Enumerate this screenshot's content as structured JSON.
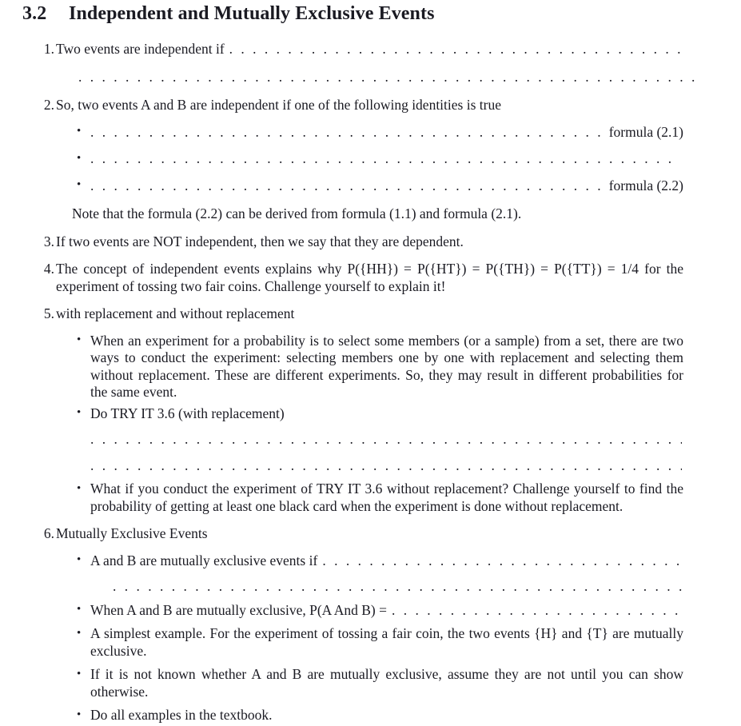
{
  "document": {
    "section_number": "3.2",
    "section_title": "Independent and Mutually Exclusive Events",
    "dot_filler": ". . . . . . . . . . . . . . . . . . . . . . . . . . . . . . . . . . . . . . . . . . . . . . . . . . . . . . . . . . . . . . . . . . . . . . . . . . . . . . . . . . . . . . . . . . . . . . . . . . . . . . . . . . . . . . . . . . . . . . . . . . . . . . . . . . . . . . . . . . . . . . . . . .",
    "bullet_glyph": "•"
  },
  "items": {
    "n1": {
      "marker": "1.",
      "text": "Two events are independent if"
    },
    "n2": {
      "marker": "2.",
      "text": "So, two events A and B are independent if one of the following identities is true",
      "bullets": {
        "b1_tail": "formula (2.1)",
        "b2_tail": "",
        "b3_tail": "formula (2.2)"
      },
      "note": "Note that the formula (2.2) can be derived from formula (1.1) and formula (2.1)."
    },
    "n3": {
      "marker": "3.",
      "text": "If two events are NOT independent, then we say that they are dependent."
    },
    "n4": {
      "marker": "4.",
      "text": "The concept of independent events explains why P({HH}) = P({HT}) = P({TH}) = P({TT}) = 1/4 for the experiment of tossing two fair coins. Challenge yourself to explain it!"
    },
    "n5": {
      "marker": "5.",
      "text": "with replacement and without replacement",
      "bullets": {
        "b1": "When an experiment for a probability is to select some members (or a sample) from a set, there are two ways to conduct the experiment: selecting members one by one with replacement and selecting them without replacement. These are different experiments. So, they may result in different probabilities for the same event.",
        "b2": "Do TRY IT 3.6 (with replacement)",
        "b3": "What if you conduct the experiment of TRY IT 3.6 without replacement? Challenge yourself to find the probability of getting at least one black card when the experiment is done without replacement."
      }
    },
    "n6": {
      "marker": "6.",
      "text": "Mutually Exclusive Events",
      "bullets": {
        "b1": "A and B are mutually exclusive events if",
        "b2": "When A and B are mutually exclusive, P(A And B) =",
        "b3": "A simplest example. For the experiment of tossing a fair coin, the two events {H} and {T} are mutually exclusive.",
        "b4": "If it is not known whether A and B are mutually exclusive, assume they are not until you can show otherwise.",
        "b5": "Do all examples in the textbook."
      }
    }
  }
}
